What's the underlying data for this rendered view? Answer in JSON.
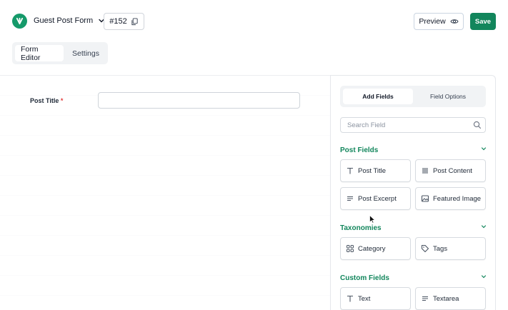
{
  "header": {
    "form_name": "Guest Post Form",
    "form_id": "#152",
    "preview_label": "Preview",
    "save_label": "Save"
  },
  "tabs": [
    {
      "label": "Form Editor",
      "active": true
    },
    {
      "label": "Settings",
      "active": false
    }
  ],
  "canvas": {
    "fields": [
      {
        "label": "Post Title",
        "required_mark": "*"
      }
    ]
  },
  "panel": {
    "tabs": [
      {
        "label": "Add Fields",
        "active": true
      },
      {
        "label": "Field Options",
        "active": false
      }
    ],
    "search_placeholder": "Search Field",
    "sections": [
      {
        "title": "Post Fields",
        "items": [
          {
            "label": "Post Title",
            "icon": "text-type-icon"
          },
          {
            "label": "Post Content",
            "icon": "paragraph-icon"
          },
          {
            "label": "Post Excerpt",
            "icon": "lines-icon"
          },
          {
            "label": "Featured Image",
            "icon": "image-icon"
          }
        ]
      },
      {
        "title": "Taxonomies",
        "items": [
          {
            "label": "Category",
            "icon": "grid-icon"
          },
          {
            "label": "Tags",
            "icon": "tag-icon"
          }
        ]
      },
      {
        "title": "Custom Fields",
        "items": [
          {
            "label": "Text",
            "icon": "text-type-icon"
          },
          {
            "label": "Textarea",
            "icon": "lines-icon"
          }
        ]
      }
    ]
  },
  "colors": {
    "brand": "#12865c",
    "required": "#e23c3c"
  }
}
